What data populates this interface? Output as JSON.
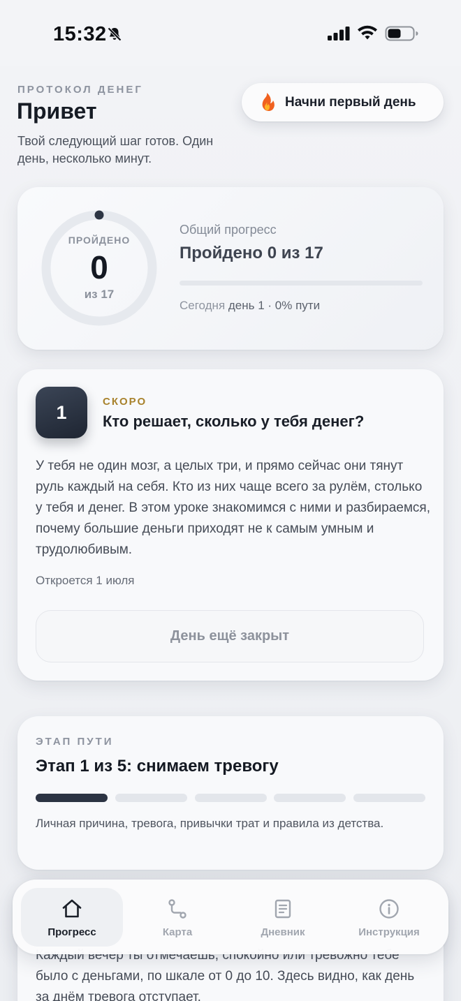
{
  "status_bar": {
    "time": "15:32"
  },
  "header": {
    "eyebrow": "ПРОТОКОЛ ДЕНЕГ",
    "greeting": "Привет",
    "subtitle": "Твой следующий шаг готов. Один день, несколько минут.",
    "start_button": {
      "icon": "fire-icon",
      "label": "Начни первый день"
    }
  },
  "progress": {
    "ring_label": "ПРОЙДЕНО",
    "completed": "0",
    "total_label": "из 17",
    "caption": "Общий прогресс",
    "title": "Пройдено 0 из 17",
    "fraction": 0,
    "today_prefix": "Сегодня",
    "today_rest": "день 1 · 0% пути"
  },
  "lesson": {
    "day_number": "1",
    "status": "СКОРО",
    "title": "Кто решает, сколько у тебя денег?",
    "body": "У тебя не один мозг, а целых три, и прямо сейчас они тянут руль каждый на себя. Кто из них чаще всего за рулём, столько у тебя и денег. В этом уроке знакомимся с ними и разбираемся, почему большие деньги приходят не к самым умным и трудолюбивым.",
    "opens": "Откроется 1 июля",
    "button_label": "День ещё закрыт"
  },
  "stage": {
    "eyebrow": "ЭТАП ПУТИ",
    "title": "Этап 1 из 5: снимаем тревогу",
    "current": 1,
    "total": 5,
    "description": "Личная причина, тревога, привычки трат и правила из детства."
  },
  "next_card": {
    "body": "Каждый вечер ты отмечаешь, спокойно или тревожно тебе было с деньгами, по шкале от 0 до 10. Здесь видно, как день за днём тревога отступает."
  },
  "tabbar": {
    "tabs": [
      {
        "label": "Прогресс",
        "icon": "home-icon",
        "active": true
      },
      {
        "label": "Карта",
        "icon": "route-icon",
        "active": false
      },
      {
        "label": "Дневник",
        "icon": "journal-icon",
        "active": false
      },
      {
        "label": "Инструкция",
        "icon": "info-icon",
        "active": false
      }
    ]
  },
  "colors": {
    "accent_dark": "#2c3443",
    "eyebrow_gold": "#a8822c",
    "background": "#eef0f4"
  }
}
